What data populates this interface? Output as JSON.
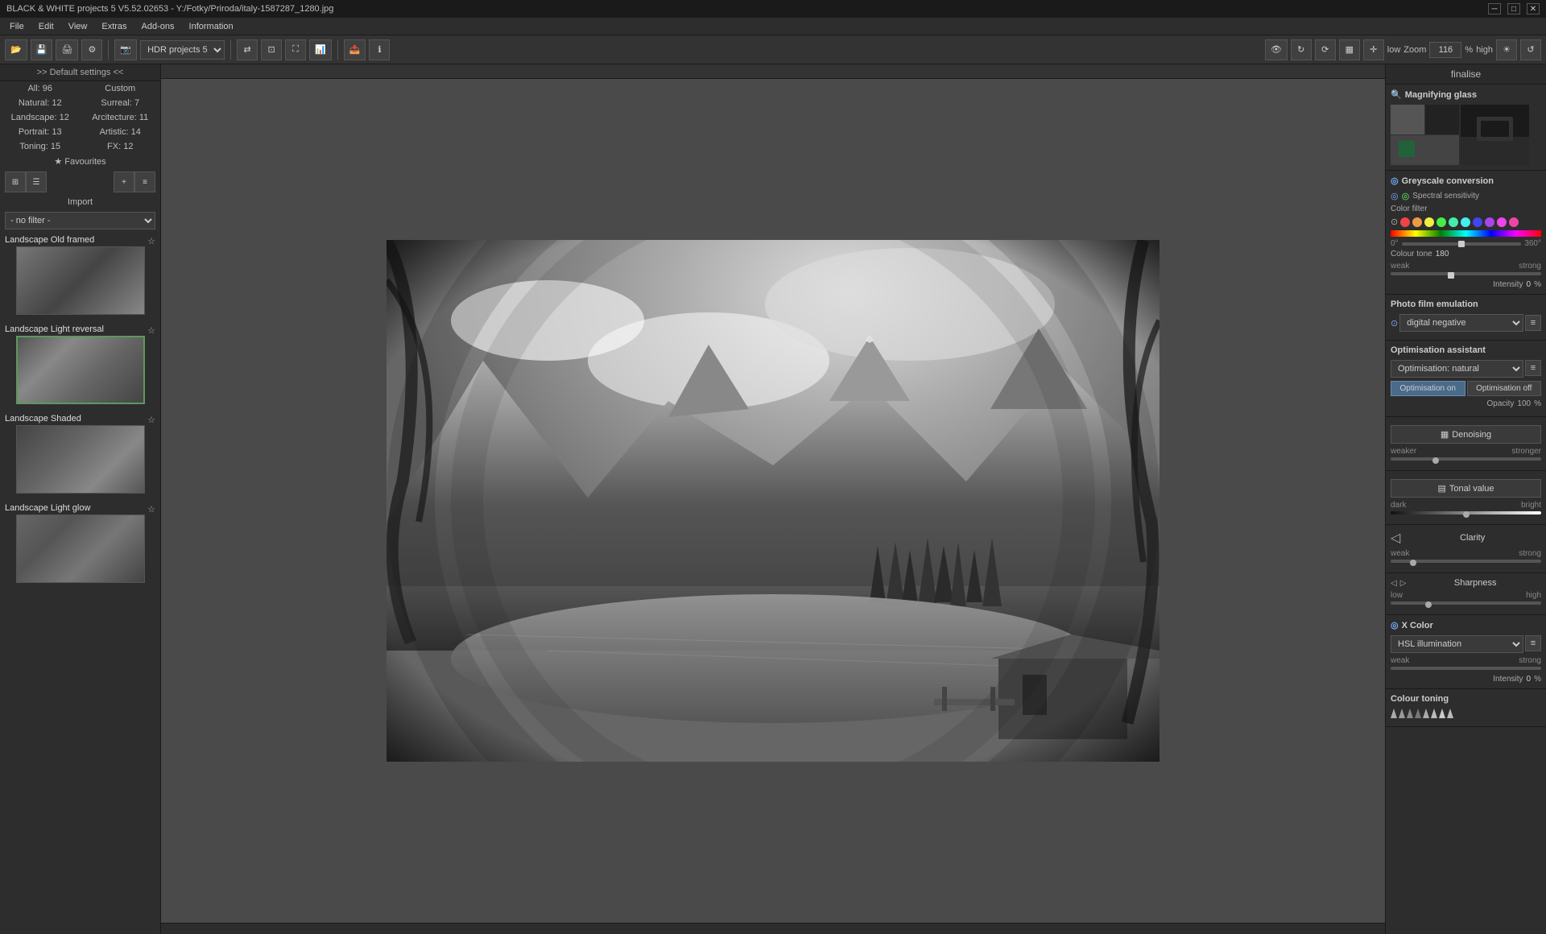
{
  "titlebar": {
    "title": "BLACK & WHITE projects 5 V5.52.02653 - Y:/Fotky/Priroda/italy-1587287_1280.jpg",
    "controls": [
      "minimize",
      "maximize",
      "close"
    ]
  },
  "menubar": {
    "items": [
      "File",
      "Edit",
      "View",
      "Extras",
      "Add-ons",
      "Information"
    ]
  },
  "toolbar": {
    "project_label": "HDR projects 5",
    "zoom_label": "Zoom",
    "zoom_value": "116",
    "zoom_unit": "%",
    "zoom_low": "low",
    "zoom_high": "high"
  },
  "left_panel": {
    "header": ">> Default settings <<",
    "counts": [
      {
        "label": "All: 96",
        "id": "all"
      },
      {
        "label": "Custom",
        "id": "custom"
      },
      {
        "label": "Natural: 12",
        "id": "natural"
      },
      {
        "label": "Surreal: 7",
        "id": "surreal"
      },
      {
        "label": "Landscape: 12",
        "id": "landscape"
      },
      {
        "label": "Arcitecture: 11",
        "id": "architecture"
      },
      {
        "label": "Portrait: 13",
        "id": "portrait"
      },
      {
        "label": "Artistic: 14",
        "id": "artistic"
      },
      {
        "label": "Toning: 15",
        "id": "toning"
      },
      {
        "label": "FX: 12",
        "id": "fx"
      }
    ],
    "favourites": "★ Favourites",
    "import": "Import",
    "filter_placeholder": "- no filter -",
    "presets": [
      {
        "name": "Landscape Old framed",
        "active": false
      },
      {
        "name": "Landscape Light reversal",
        "active": true
      },
      {
        "name": "Landscape Shaded",
        "active": false
      },
      {
        "name": "Landscape Light glow",
        "active": false
      }
    ]
  },
  "right_panel": {
    "finalise": "finalise",
    "magnifying_glass": {
      "title": "Magnifying glass"
    },
    "greyscale": {
      "title": "Greyscale conversion",
      "spectral_sensitivity": "Spectral sensitivity",
      "color_filter": "Color filter",
      "colour_tone_label": "Colour tone",
      "colour_tone_value": "180",
      "intensity_label": "Intensity",
      "intensity_value": "0",
      "intensity_unit": "%",
      "weak": "weak",
      "strong": "strong"
    },
    "photo_film": {
      "title": "Photo film emulation",
      "value": "digital negative"
    },
    "optimisation": {
      "title": "Optimisation assistant",
      "dropdown_value": "Optimisation: natural",
      "btn_on": "Optimisation on",
      "btn_off": "Optimisation off",
      "opacity_label": "Opacity",
      "opacity_value": "100",
      "opacity_unit": "%"
    },
    "denoising": {
      "label": "Denoising",
      "weak": "weaker",
      "strong": "stronger"
    },
    "tonal_value": {
      "label": "Tonal value",
      "dark": "dark",
      "bright": "bright"
    },
    "clarity": {
      "label": "Clarity",
      "weak": "weak",
      "strong": "strong"
    },
    "sharpness": {
      "label": "Sharpness",
      "low": "low",
      "high": "high"
    },
    "x_color": {
      "title": "X Color",
      "dropdown": "HSL illumination",
      "intensity_label": "Intensity",
      "intensity_value": "0",
      "intensity_unit": "%",
      "weak": "weak",
      "strong": "strong"
    },
    "colour_toning": {
      "title": "Colour toning"
    }
  },
  "colors": {
    "accent": "#5a9a5a",
    "bg_dark": "#2d2d2d",
    "bg_mid": "#333333",
    "bg_light": "#404040",
    "border": "#1a1a1a",
    "text": "#cccccc",
    "text_dim": "#aaaaaa"
  }
}
